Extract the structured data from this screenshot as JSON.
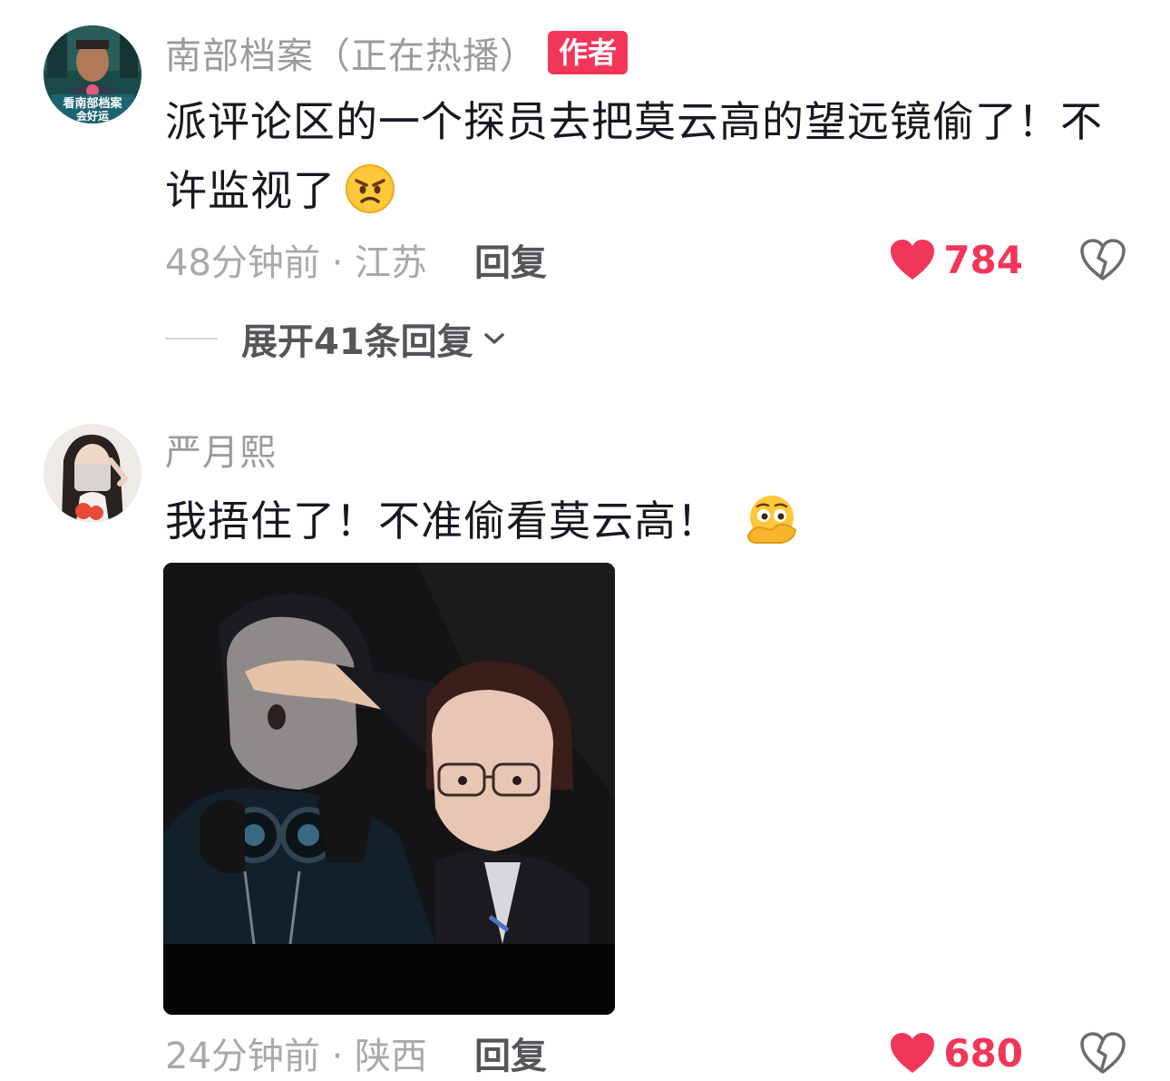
{
  "comments": [
    {
      "author": "南部档案（正在热播）",
      "badge": "作者",
      "text": "派评论区的一个探员去把莫云高的望远镜偷了！不许监视了",
      "emoji": "angry-face",
      "time_location": "48分钟前 · 江苏",
      "reply_label": "回复",
      "likes": "784",
      "expand_label": "展开41条回复",
      "avatar_caption_line1": "看南部档案",
      "avatar_caption_line2": "会好运"
    },
    {
      "author": "严月熙",
      "text": "我捂住了！不准偷看莫云高！",
      "emoji": "peeking-face",
      "time_location": "24分钟前 · 陕西",
      "reply_label": "回复",
      "likes": "680"
    }
  ],
  "colors": {
    "accent": "#f2365a",
    "text_primary": "#161823",
    "text_secondary": "#9a9aa0"
  },
  "icons": [
    "heart-icon",
    "broken-heart-icon",
    "chevron-down-icon",
    "angry-face-emoji",
    "peeking-face-emoji"
  ]
}
